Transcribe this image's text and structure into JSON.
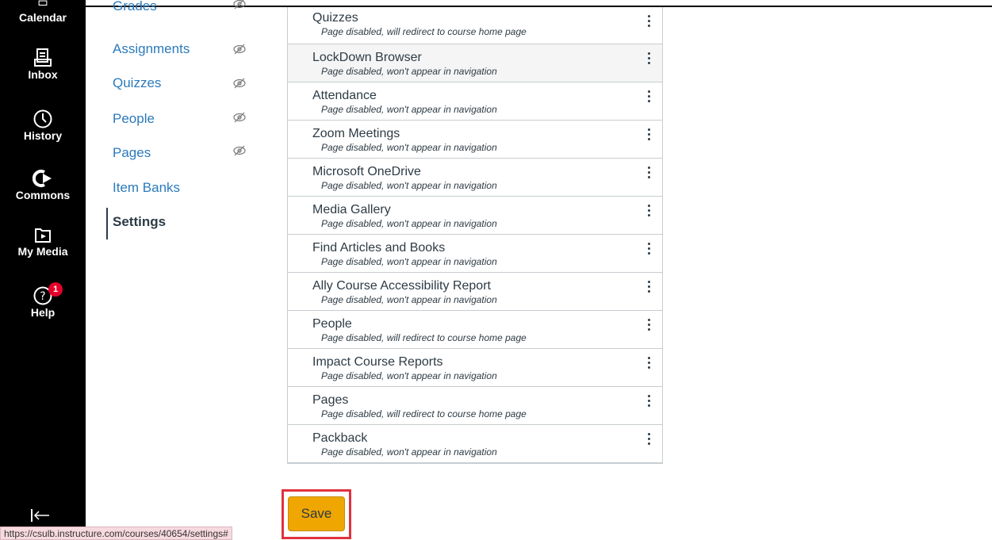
{
  "global_nav": {
    "calendar": "Calendar",
    "inbox": "Inbox",
    "history": "History",
    "commons": "Commons",
    "my_media": "My Media",
    "help": "Help",
    "help_badge": "1"
  },
  "course_nav": {
    "items": [
      {
        "label": "Grades"
      },
      {
        "label": "Assignments"
      },
      {
        "label": "Quizzes"
      },
      {
        "label": "People"
      },
      {
        "label": "Pages"
      },
      {
        "label": "Item Banks"
      },
      {
        "label": "Settings"
      }
    ]
  },
  "nav_list": {
    "items": [
      {
        "title": "Quizzes",
        "status": "Page disabled, will redirect to course home page"
      },
      {
        "title": "LockDown Browser",
        "status": "Page disabled, won't appear in navigation"
      },
      {
        "title": "Attendance",
        "status": "Page disabled, won't appear in navigation"
      },
      {
        "title": "Zoom Meetings",
        "status": "Page disabled, won't appear in navigation"
      },
      {
        "title": "Microsoft OneDrive",
        "status": "Page disabled, won't appear in navigation"
      },
      {
        "title": "Media Gallery",
        "status": "Page disabled, won't appear in navigation"
      },
      {
        "title": "Find Articles and Books",
        "status": "Page disabled, won't appear in navigation"
      },
      {
        "title": "Ally Course Accessibility Report",
        "status": "Page disabled, won't appear in navigation"
      },
      {
        "title": "People",
        "status": "Page disabled, will redirect to course home page"
      },
      {
        "title": "Impact Course Reports",
        "status": "Page disabled, won't appear in navigation"
      },
      {
        "title": "Pages",
        "status": "Page disabled, will redirect to course home page"
      },
      {
        "title": "Packback",
        "status": "Page disabled, won't appear in navigation"
      }
    ]
  },
  "save_label": "Save",
  "status_url": "https://csulb.instructure.com/courses/40654/settings#",
  "colors": {
    "accent": "#efa600",
    "link": "#2b7abc",
    "highlight": "#e0323d",
    "badge": "#e4002b"
  }
}
